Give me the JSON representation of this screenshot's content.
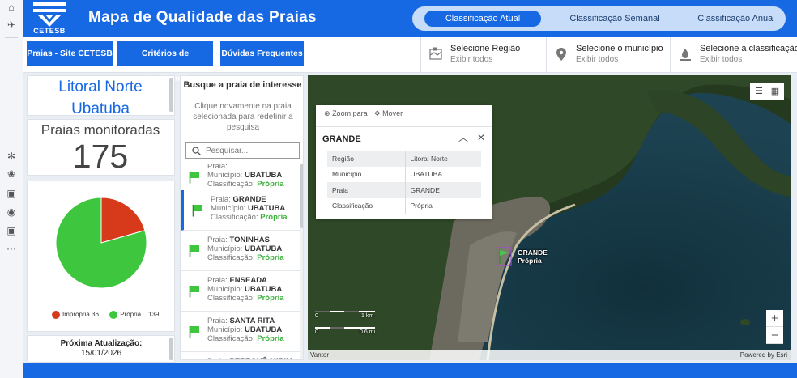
{
  "header": {
    "logo_text": "CETESB",
    "title": "Mapa de Qualidade das Praias",
    "tabs": [
      {
        "label": "Classificação Atual",
        "active": true
      },
      {
        "label": "Classificação Semanal",
        "active": false
      },
      {
        "label": "Classificação Anual",
        "active": false
      }
    ]
  },
  "toolbar": {
    "buttons": [
      "Praias - Site CETESB",
      "Critérios de Classificação",
      "Dúvidas Frequentes"
    ],
    "filters": [
      {
        "title": "Selecione Região",
        "value": "Exibir todos",
        "icon": "map-region-icon"
      },
      {
        "title": "Selecione o município",
        "value": "Exibir todos",
        "icon": "map-pin-icon"
      },
      {
        "title": "Selecione a classificação",
        "value": "Exibir todos",
        "icon": "water-drop-icon"
      }
    ]
  },
  "summary": {
    "region": "Litoral Norte",
    "municipality": "Ubatuba",
    "monitored_label": "Praias monitoradas",
    "monitored_count": "175",
    "next_update_label": "Próxima Atualização:",
    "next_update_date": "15/01/2026"
  },
  "chart_data": {
    "type": "pie",
    "categories": [
      "Imprópria",
      "Própria"
    ],
    "values": [
      36,
      139
    ],
    "colors": [
      "#d7391b",
      "#3ec73e"
    ],
    "legend": "bottom"
  },
  "search": {
    "title": "Busque a praia de interesse",
    "hint": "Clique novamente na praia selecionada para redefinir a pesquisa",
    "placeholder": "Pesquisar..."
  },
  "list": {
    "praia_label": "Praia:",
    "municipio_label": "Município:",
    "classificacao_label": "Classificação:",
    "items": [
      {
        "praia": "",
        "municipio": "UBATUBA",
        "classificacao": "Própria",
        "selected": false
      },
      {
        "praia": "GRANDE",
        "municipio": "UBATUBA",
        "classificacao": "Própria",
        "selected": true
      },
      {
        "praia": "TONINHAS",
        "municipio": "UBATUBA",
        "classificacao": "Própria",
        "selected": false
      },
      {
        "praia": "ENSEADA",
        "municipio": "UBATUBA",
        "classificacao": "Própria",
        "selected": false
      },
      {
        "praia": "SANTA RITA",
        "municipio": "UBATUBA",
        "classificacao": "Própria",
        "selected": false
      },
      {
        "praia": "PEREQUÊ-MIRIM",
        "municipio": "",
        "classificacao": "",
        "selected": false
      }
    ]
  },
  "map": {
    "zoom_to": "Zoom para",
    "move": "Mover",
    "popup": {
      "title": "GRANDE",
      "rows": [
        {
          "key": "Região",
          "value": "Litoral Norte"
        },
        {
          "key": "Município",
          "value": "UBATUBA"
        },
        {
          "key": "Praia",
          "value": "GRANDE"
        },
        {
          "key": "Classificação",
          "value": "Própria"
        }
      ]
    },
    "marker": {
      "name": "GRANDE",
      "status": "Própria"
    },
    "scale": {
      "km": "1 km",
      "mi": "0.6 mi"
    },
    "attribution_left": "Vantor",
    "attribution_right": "Powered by Esri"
  }
}
